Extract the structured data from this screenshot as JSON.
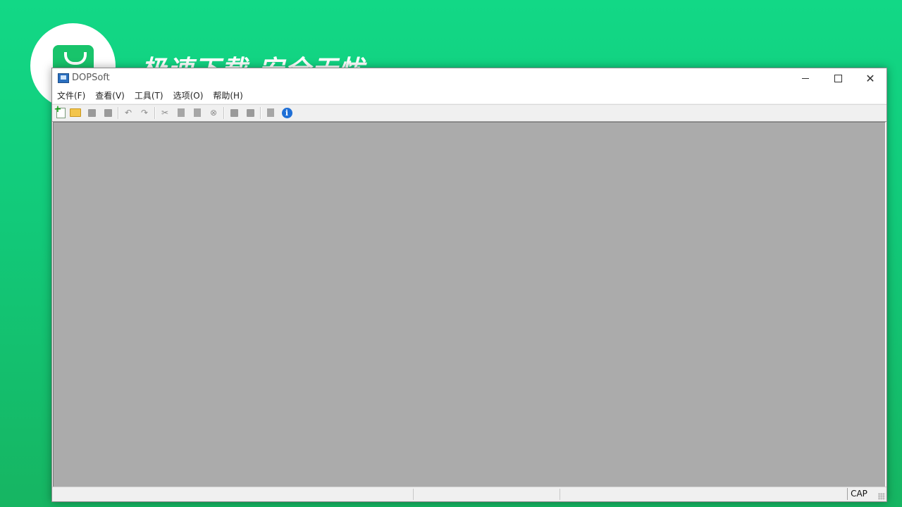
{
  "background": {
    "slogan": "极速下载 安全无忧",
    "brand_color": "#12d886"
  },
  "window": {
    "title": "DOPSoft",
    "controls": {
      "minimize": "minimize-icon",
      "maximize": "maximize-icon",
      "close": "close-icon"
    }
  },
  "menu": {
    "items": [
      {
        "label": "文件(F)"
      },
      {
        "label": "查看(V)"
      },
      {
        "label": "工具(T)"
      },
      {
        "label": "选项(O)"
      },
      {
        "label": "帮助(H)"
      }
    ]
  },
  "toolbar": {
    "icons": [
      "new-icon",
      "open-icon",
      "save-icon",
      "save-all-icon",
      "undo-icon",
      "redo-icon",
      "cut-icon",
      "copy-icon",
      "paste-icon",
      "find-icon",
      "download-icon",
      "upload-icon",
      "print-icon",
      "about-icon"
    ],
    "info_glyph": "i",
    "undo_glyph": "↶",
    "redo_glyph": "↷",
    "cut_glyph": "✂",
    "find_glyph": "⊗"
  },
  "workspace": {
    "background_color": "#ababab"
  },
  "statusbar": {
    "cap_indicator": "CAP"
  }
}
